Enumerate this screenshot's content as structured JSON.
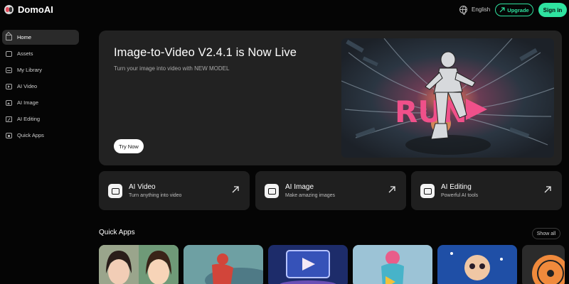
{
  "app": {
    "name": "DomoAI"
  },
  "header": {
    "language": "English",
    "upgrade_label": "Upgrade",
    "signin_label": "Sign in"
  },
  "sidebar": {
    "items": [
      {
        "label": "Home",
        "icon": "home-icon",
        "active": true
      },
      {
        "label": "Assets",
        "icon": "assets-icon"
      },
      {
        "label": "My Library",
        "icon": "library-icon"
      },
      {
        "label": "AI Video",
        "icon": "video-icon"
      },
      {
        "label": "AI Image",
        "icon": "image-icon"
      },
      {
        "label": "AI Editing",
        "icon": "editing-icon"
      },
      {
        "label": "Quick Apps",
        "icon": "apps-icon"
      }
    ]
  },
  "hero": {
    "title": "Image-to-Video V2.4.1 is Now Live",
    "subtitle": "Turn your image into video with NEW MODEL",
    "cta": "Try Now",
    "art_word": "RUN"
  },
  "features": [
    {
      "title": "AI Video",
      "subtitle": "Turn anything into video",
      "icon": "video-icon"
    },
    {
      "title": "AI Image",
      "subtitle": "Make amazing images",
      "icon": "image-icon"
    },
    {
      "title": "AI Editing",
      "subtitle": "Powerful AI tools",
      "icon": "editing-icon"
    }
  ],
  "quick_apps": {
    "title": "Quick Apps",
    "show_all": "Show all",
    "thumbnails": [
      "anime-portrait-thumbnail",
      "red-figure-thumbnail",
      "play-frame-thumbnail",
      "colorful-figure-thumbnail",
      "skull-art-thumbnail",
      "vinyl-thumbnail"
    ]
  },
  "colors": {
    "accent": "#2fe3a0",
    "background": "#050505",
    "card": "#1f1f1f",
    "hero": "#222222"
  }
}
